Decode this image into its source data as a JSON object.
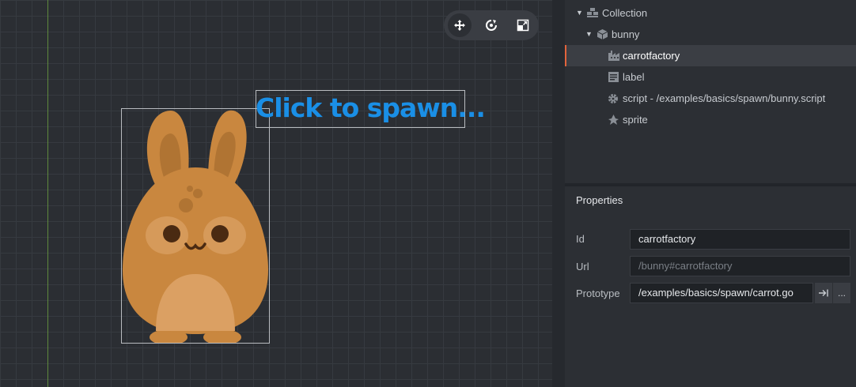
{
  "scene": {
    "label_text": "Click to spawn...",
    "toolbar": [
      "move-tool",
      "rotate-tool",
      "scale-tool"
    ]
  },
  "outline": {
    "items": [
      {
        "label": "Collection",
        "icon": "collection-icon",
        "expanded": true
      },
      {
        "label": "bunny",
        "icon": "game-object-icon",
        "expanded": true
      },
      {
        "label": "carrotfactory",
        "icon": "factory-icon",
        "selected": true
      },
      {
        "label": "label",
        "icon": "label-icon"
      },
      {
        "label": "script - /examples/basics/spawn/bunny.script",
        "icon": "gear-icon"
      },
      {
        "label": "sprite",
        "icon": "sprite-icon"
      }
    ]
  },
  "properties": {
    "title": "Properties",
    "id_label": "Id",
    "id_value": "carrotfactory",
    "url_label": "Url",
    "url_placeholder": "/bunny#carrotfactory",
    "prototype_label": "Prototype",
    "prototype_value": "/examples/basics/spawn/carrot.go",
    "prototype_more": "..."
  },
  "colors": {
    "accent_selected": "#e2643c",
    "label_blue": "#1a8fe6",
    "bunny_body": "#c9873f"
  }
}
